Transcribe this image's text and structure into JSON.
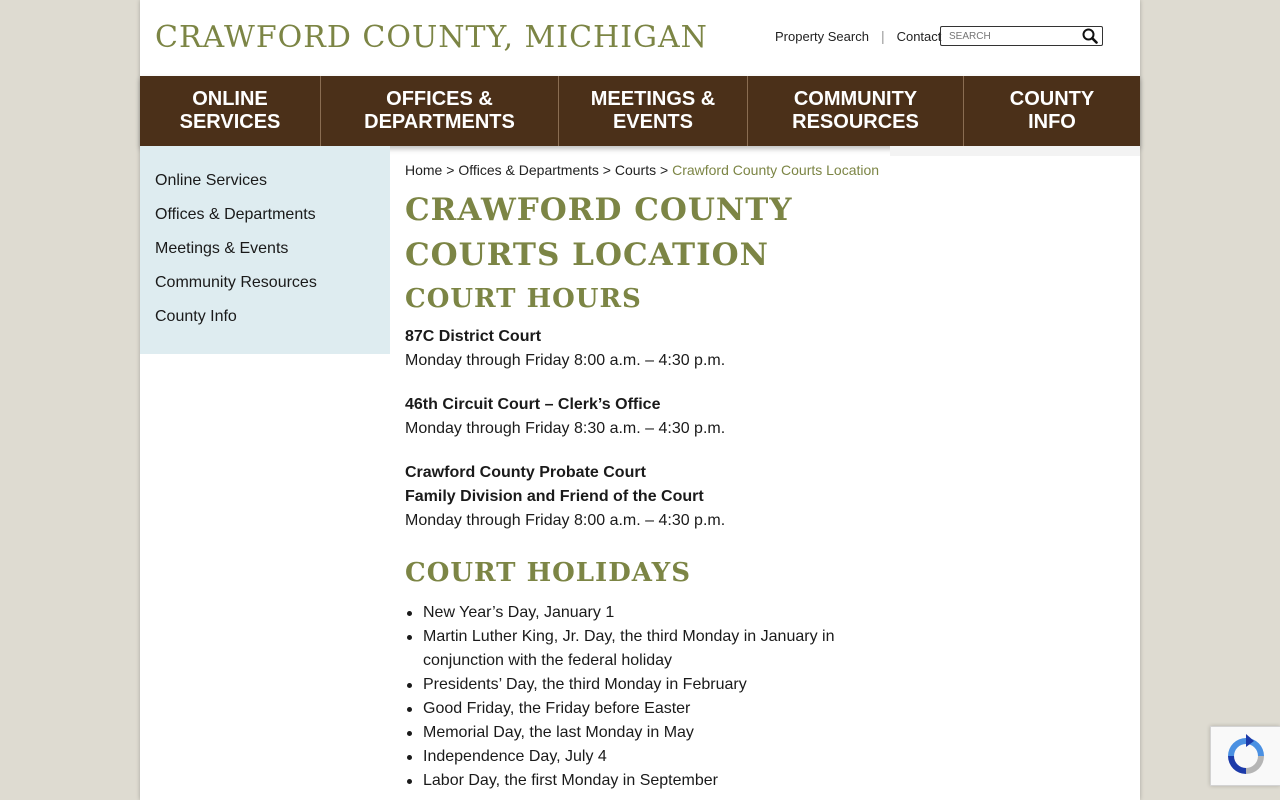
{
  "site": {
    "title": "CRAWFORD COUNTY, MICHIGAN"
  },
  "utility": {
    "property_search": "Property Search",
    "separator": "|",
    "contact": "Contact",
    "search_placeholder": "SEARCH"
  },
  "nav": {
    "items": [
      {
        "label": "ONLINE\nSERVICES"
      },
      {
        "label": "OFFICES &\nDEPARTMENTS"
      },
      {
        "label": "MEETINGS &\nEVENTS"
      },
      {
        "label": "COMMUNITY\nRESOURCES"
      },
      {
        "label": "COUNTY\nINFO"
      }
    ]
  },
  "sidebar": {
    "items": [
      {
        "label": "Online Services"
      },
      {
        "label": "Offices & Departments"
      },
      {
        "label": "Meetings & Events"
      },
      {
        "label": "Community Resources"
      },
      {
        "label": "County Info"
      }
    ]
  },
  "breadcrumb": {
    "home": "Home",
    "sep": " > ",
    "offices": "Offices & Departments",
    "courts": "Courts",
    "current": "Crawford County Courts Location"
  },
  "main": {
    "page_title_line1": "CRAWFORD COUNTY",
    "page_title_line2": "COURTS LOCATION",
    "hours_heading": "COURT HOURS",
    "courts": [
      {
        "name": "87C District Court",
        "name2": "",
        "hours": "Monday through Friday 8:00 a.m. – 4:30 p.m."
      },
      {
        "name": "46th Circuit Court – Clerk’s Office",
        "name2": "",
        "hours": "Monday through Friday 8:30 a.m. – 4:30 p.m."
      },
      {
        "name": "Crawford County Probate Court",
        "name2": "Family Division and Friend of the Court",
        "hours": "Monday through Friday 8:00 a.m. – 4:30 p.m."
      }
    ],
    "holidays_heading": "COURT HOLIDAYS",
    "holidays": [
      "New Year’s Day, January 1",
      "Martin Luther King, Jr. Day, the third Monday in January in conjunction with the federal holiday",
      "Presidents’ Day, the third Monday in February",
      "Good Friday, the Friday before Easter",
      "Memorial Day, the last Monday in May",
      "Independence Day, July 4",
      "Labor Day, the first Monday in September"
    ]
  },
  "colors": {
    "accent": "#7c8545",
    "nav_bg": "#4b3019",
    "sidebar_bg": "#deecf0",
    "page_bg": "#dedbd1"
  }
}
